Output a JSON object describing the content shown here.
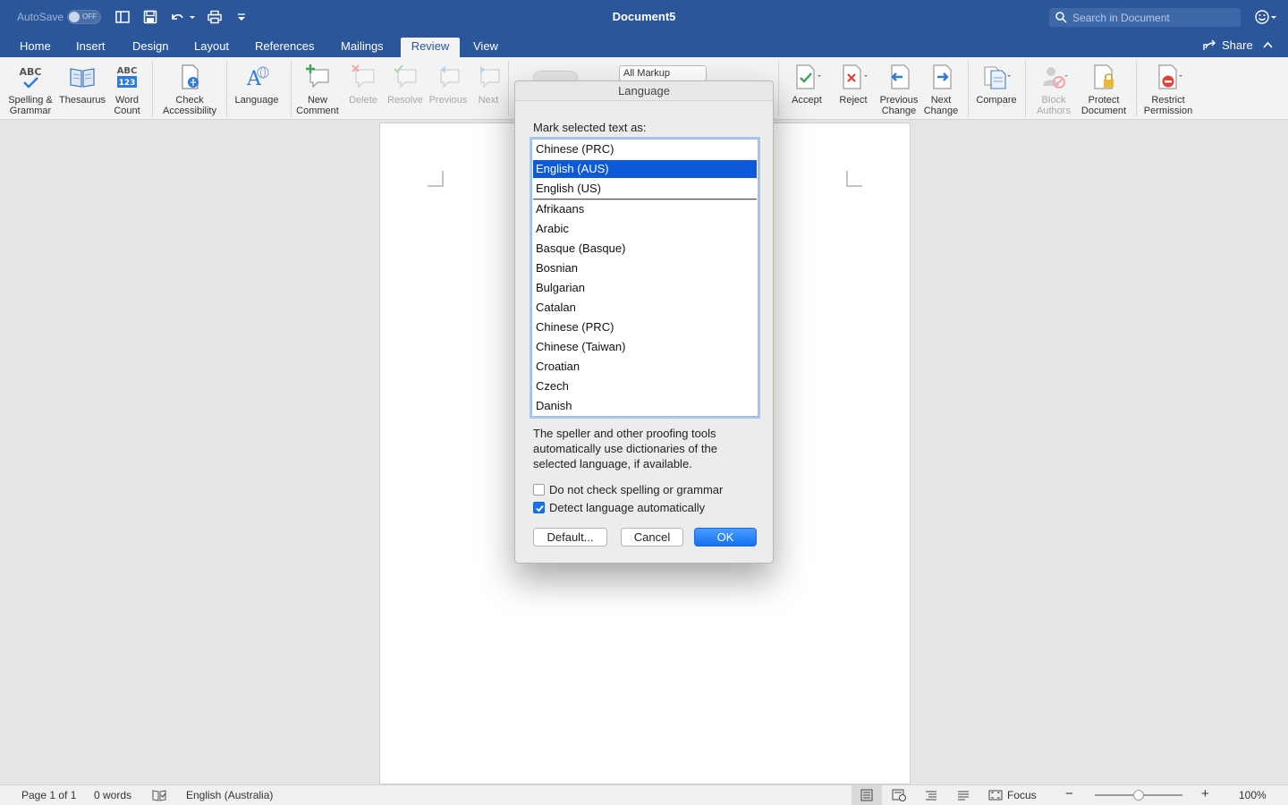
{
  "app": {
    "autosave_label": "AutoSave",
    "autosave_state": "OFF",
    "document_title": "Document5",
    "search_placeholder": "Search in Document",
    "share_label": "Share"
  },
  "tabs": [
    {
      "label": "Home"
    },
    {
      "label": "Insert"
    },
    {
      "label": "Design"
    },
    {
      "label": "Layout"
    },
    {
      "label": "References"
    },
    {
      "label": "Mailings"
    },
    {
      "label": "Review",
      "active": true
    },
    {
      "label": "View"
    }
  ],
  "ribbon": {
    "spelling_line1": "Spelling &",
    "spelling_line2": "Grammar",
    "thesaurus": "Thesaurus",
    "word_count_line1": "Word",
    "word_count_line2": "Count",
    "check_acc_line1": "Check",
    "check_acc_line2": "Accessibility",
    "language": "Language",
    "new_comment_line1": "New",
    "new_comment_line2": "Comment",
    "delete": "Delete",
    "resolve": "Resolve",
    "previous": "Previous",
    "next": "Next",
    "markup_select": "All Markup",
    "accept": "Accept",
    "reject": "Reject",
    "prev_change_line1": "Previous",
    "prev_change_line2": "Change",
    "next_change_line1": "Next",
    "next_change_line2": "Change",
    "compare": "Compare",
    "block_authors_line1": "Block",
    "block_authors_line2": "Authors",
    "protect_doc_line1": "Protect",
    "protect_doc_line2": "Document",
    "restrict_perm_line1": "Restrict",
    "restrict_perm_line2": "Permission",
    "abc_text": "ABC",
    "abc123_text": "123"
  },
  "dialog": {
    "title": "Language",
    "prompt": "Mark selected text as:",
    "languages_recent": [
      "Chinese (PRC)",
      "English (AUS)",
      "English (US)"
    ],
    "selected": "English (AUS)",
    "languages_all": [
      "Afrikaans",
      "Arabic",
      "Basque (Basque)",
      "Bosnian",
      "Bulgarian",
      "Catalan",
      "Chinese (PRC)",
      "Chinese (Taiwan)",
      "Croatian",
      "Czech",
      "Danish"
    ],
    "description": "The speller and other proofing tools automatically use dictionaries of the selected language, if available.",
    "no_check_label": "Do not check spelling or grammar",
    "no_check_checked": false,
    "detect_label": "Detect language automatically",
    "detect_checked": true,
    "default_button": "Default...",
    "cancel_button": "Cancel",
    "ok_button": "OK"
  },
  "status": {
    "page": "Page 1 of 1",
    "words": "0 words",
    "language": "English (Australia)",
    "focus": "Focus",
    "zoom": "100%",
    "zoom_fraction": 0.5
  },
  "colors": {
    "brand": "#2b579a",
    "selection": "#0a5ad9",
    "primary_button": "#1472f0"
  }
}
